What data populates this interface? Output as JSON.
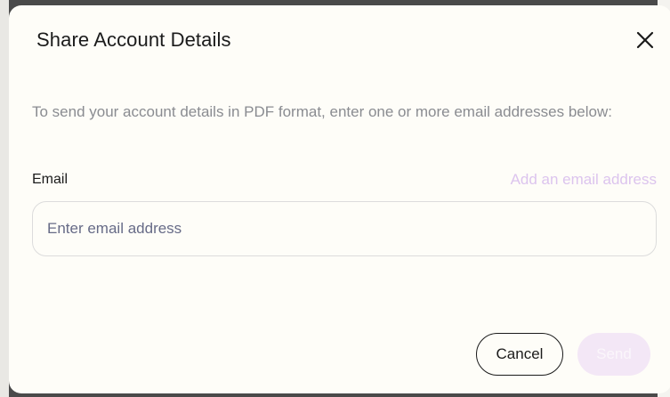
{
  "dialog": {
    "title": "Share Account Details",
    "close_icon": "close-icon",
    "description": "To send your account details in PDF format, enter one or more email addresses below:",
    "email_label": "Email",
    "add_email_link": "Add an email address",
    "email_input": {
      "value": "",
      "placeholder": "Enter email address"
    },
    "cancel_label": "Cancel",
    "send_label": "Send"
  },
  "colors": {
    "dialog_background": "#fefdf8",
    "add_link": "#dcc4ee",
    "send_button_disabled": "#f3e7f6",
    "placeholder": "#676b87"
  }
}
